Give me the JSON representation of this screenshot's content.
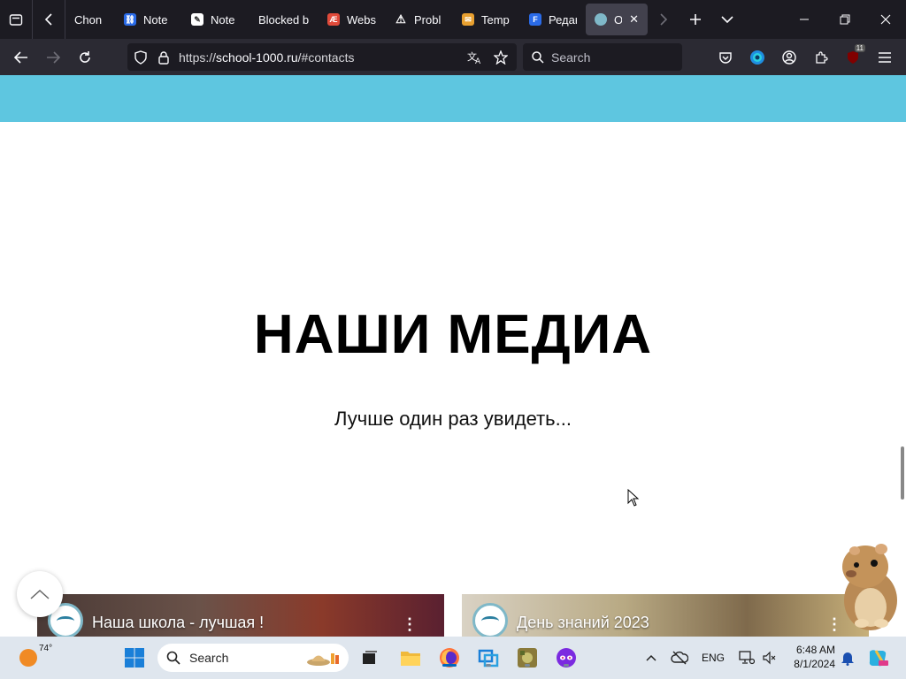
{
  "browser": {
    "tabs": [
      {
        "label": "Chon",
        "favicon": "chrome-icon",
        "color": "#3a3a45"
      },
      {
        "label": "Note",
        "favicon": "link-icon",
        "color": "#2a6be8"
      },
      {
        "label": "Note",
        "favicon": "note-icon",
        "color": "#ffffff"
      },
      {
        "label": "Blocked b",
        "favicon": "",
        "color": ""
      },
      {
        "label": "Webs",
        "favicon": "ae-icon",
        "color": "#e04a3a"
      },
      {
        "label": "Probl",
        "favicon": "warning-icon",
        "color": "#ffffff"
      },
      {
        "label": "Temp",
        "favicon": "mail-icon",
        "color": "#e8a030"
      },
      {
        "label": "Редак",
        "favicon": "f-icon",
        "color": "#2a6be8"
      },
      {
        "label": "Об",
        "favicon": "globe-icon",
        "color": "#7fb8c8"
      }
    ],
    "url_prefix": "https://",
    "url_domain": "school-1000.ru",
    "url_path": "/#contacts",
    "search_placeholder": "Search",
    "ext_badge": "11"
  },
  "page": {
    "heading": "НАШИ МЕДИА",
    "subheading": "Лучше один раз увидеть...",
    "videos": [
      {
        "title": "Наша школа - лучшая !"
      },
      {
        "title": "День знаний 2023"
      }
    ],
    "banner_color": "#5ec6e0"
  },
  "taskbar": {
    "weather_temp": "74°",
    "search_placeholder": "Search",
    "language": "ENG",
    "time": "6:48 AM",
    "date": "8/1/2024"
  }
}
